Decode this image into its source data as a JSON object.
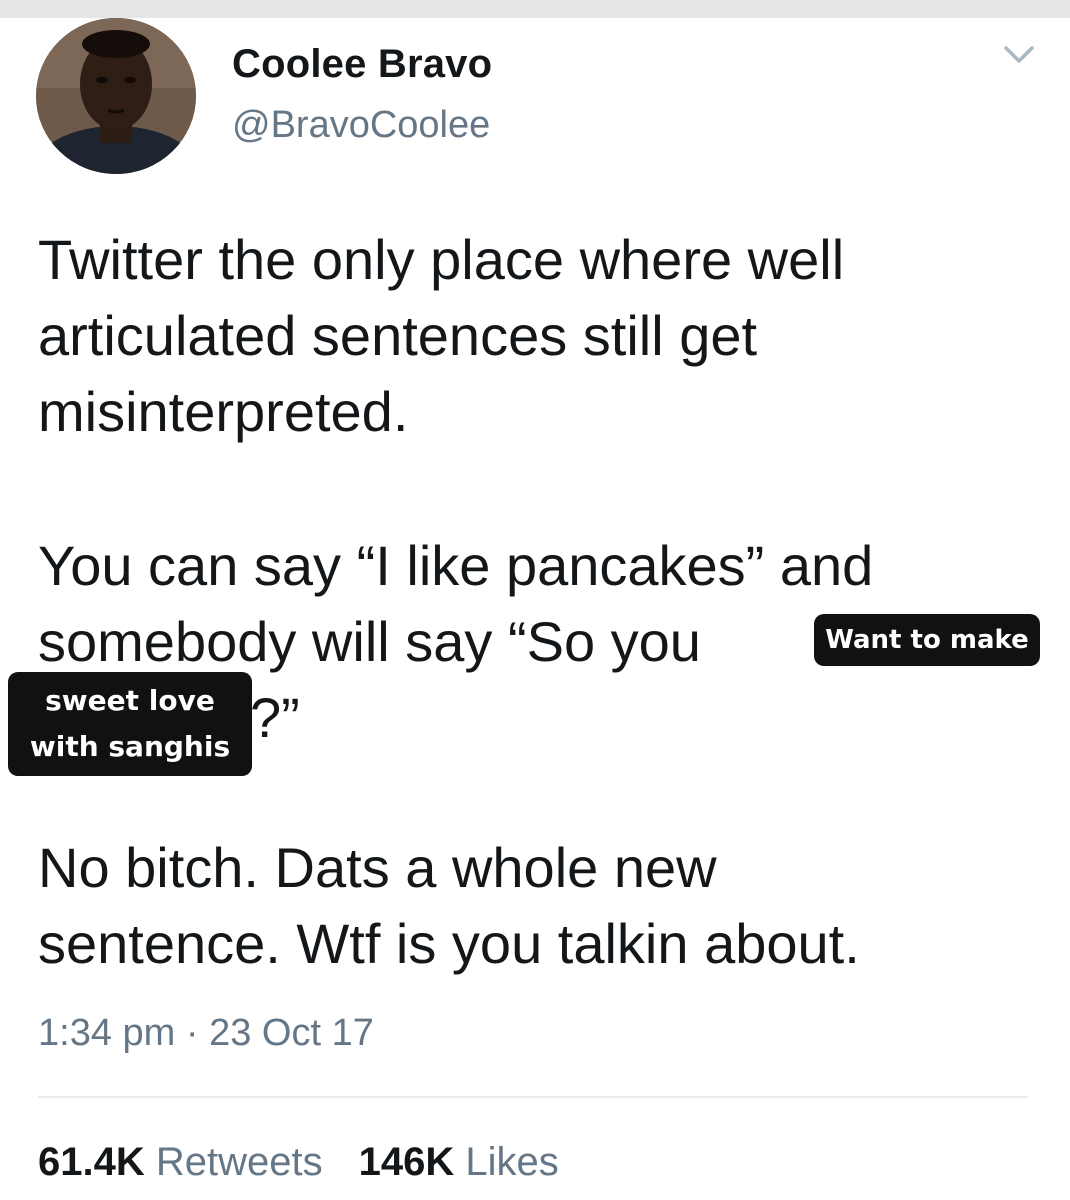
{
  "user": {
    "name": "Coolee Bravo",
    "handle": "@BravoCoolee"
  },
  "tweet": {
    "line1": "Twitter the only place where well",
    "line2": "articulated sentences still get",
    "line3": "misinterpreted.",
    "line4": "You can say “I like pancakes” and",
    "line5_start": "somebody will say “So you",
    "line6_end": "?”",
    "line7": "No bitch. Dats a whole new",
    "line8": "sentence. Wtf is you talkin about.",
    "timestamp": "1:34 pm · 23 Oct 17"
  },
  "stickers": {
    "first": "Want to make",
    "second_line1": "sweet love",
    "second_line2": "with sanghis"
  },
  "stats": {
    "retweets_count": "61.4K",
    "retweets_label": "Retweets",
    "likes_count": "146K",
    "likes_label": "Likes"
  },
  "icons": {
    "avatar": "profile-photo",
    "menu": "chevron-down-icon"
  },
  "colors": {
    "text": "#14171a",
    "muted": "#657786",
    "sticker_bg": "#111111",
    "divider": "#e6ecf0"
  }
}
